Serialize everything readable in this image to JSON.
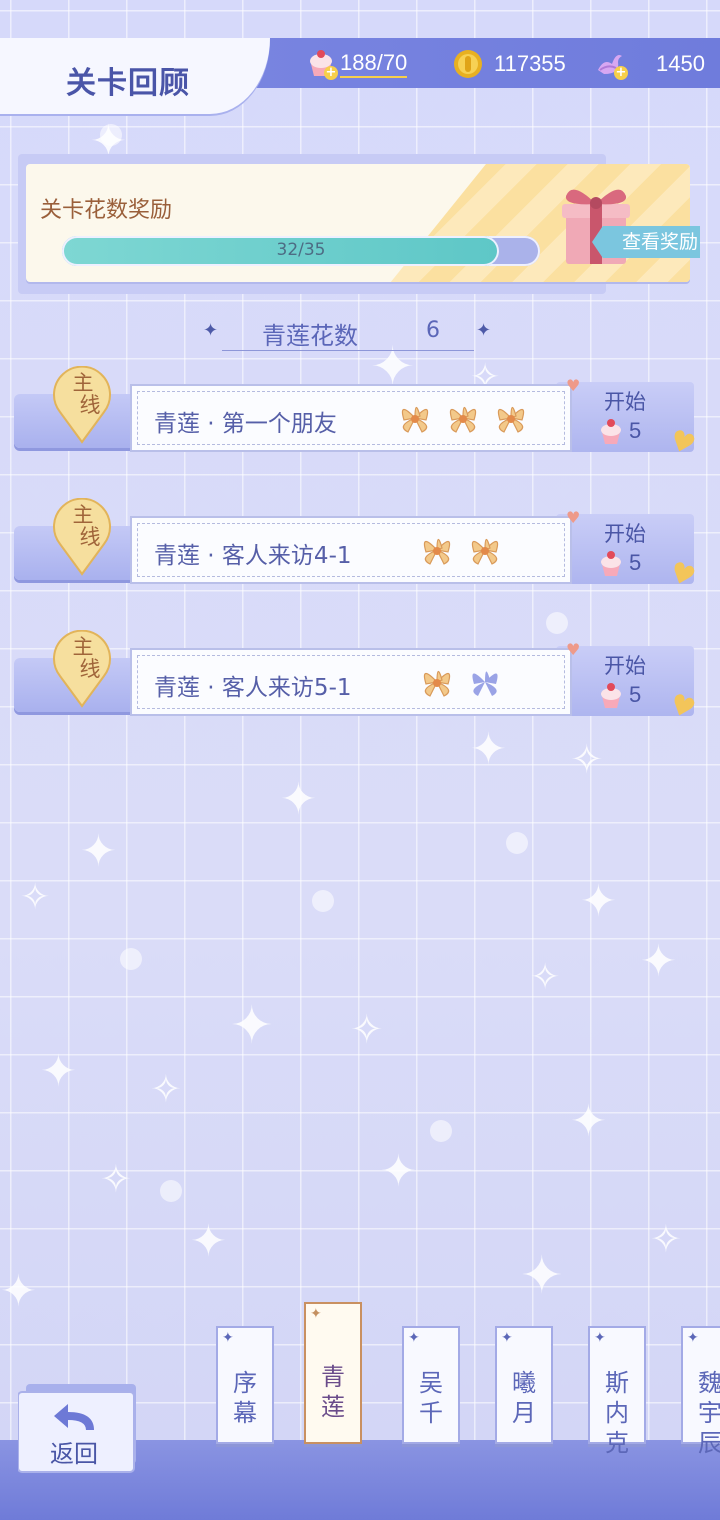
{
  "header": {
    "title": "关卡回顾",
    "stamina": "188/70",
    "coins": "117355",
    "diamonds": "1450"
  },
  "reward": {
    "title": "关卡花数奖励",
    "progress_text": "32/35",
    "progress_fraction": 0.914,
    "view_button": "查看奖励"
  },
  "flower_count": {
    "label": "青莲花数",
    "value": "6"
  },
  "levels": [
    {
      "tag_top": "主",
      "tag_bottom": "线",
      "name": "青莲 · 第一个朋友",
      "start": "开始",
      "cost": "5",
      "flowers_earned": 3,
      "flowers_total": 3
    },
    {
      "tag_top": "主",
      "tag_bottom": "线",
      "name": "青莲 · 客人来访4-1",
      "start": "开始",
      "cost": "5",
      "flowers_earned": 2,
      "flowers_total": 2
    },
    {
      "tag_top": "主",
      "tag_bottom": "线",
      "name": "青莲 · 客人来访5-1",
      "start": "开始",
      "cost": "5",
      "flowers_earned": 1,
      "flowers_total": 2
    }
  ],
  "bottom": {
    "back_label": "返回",
    "tabs": [
      {
        "label": "序\n幕",
        "active": false
      },
      {
        "label": "青\n莲",
        "active": true
      },
      {
        "label": "吴\n千",
        "active": false
      },
      {
        "label": "曦\n月",
        "active": false
      },
      {
        "label": "斯\n内\n克",
        "active": false
      },
      {
        "label": "魏\n宇\n辰",
        "active": false
      }
    ]
  },
  "colors": {
    "accent": "#6f7cdc",
    "text_primary": "#565fa8",
    "flower": "#f3c98a",
    "flower_missing": "#9aa3e6"
  },
  "icons": [
    "cupcake-icon",
    "coin-icon",
    "swan-icon",
    "gift-icon",
    "flower-icon",
    "back-arrow-icon",
    "heart-icon",
    "sparkle-icon"
  ]
}
